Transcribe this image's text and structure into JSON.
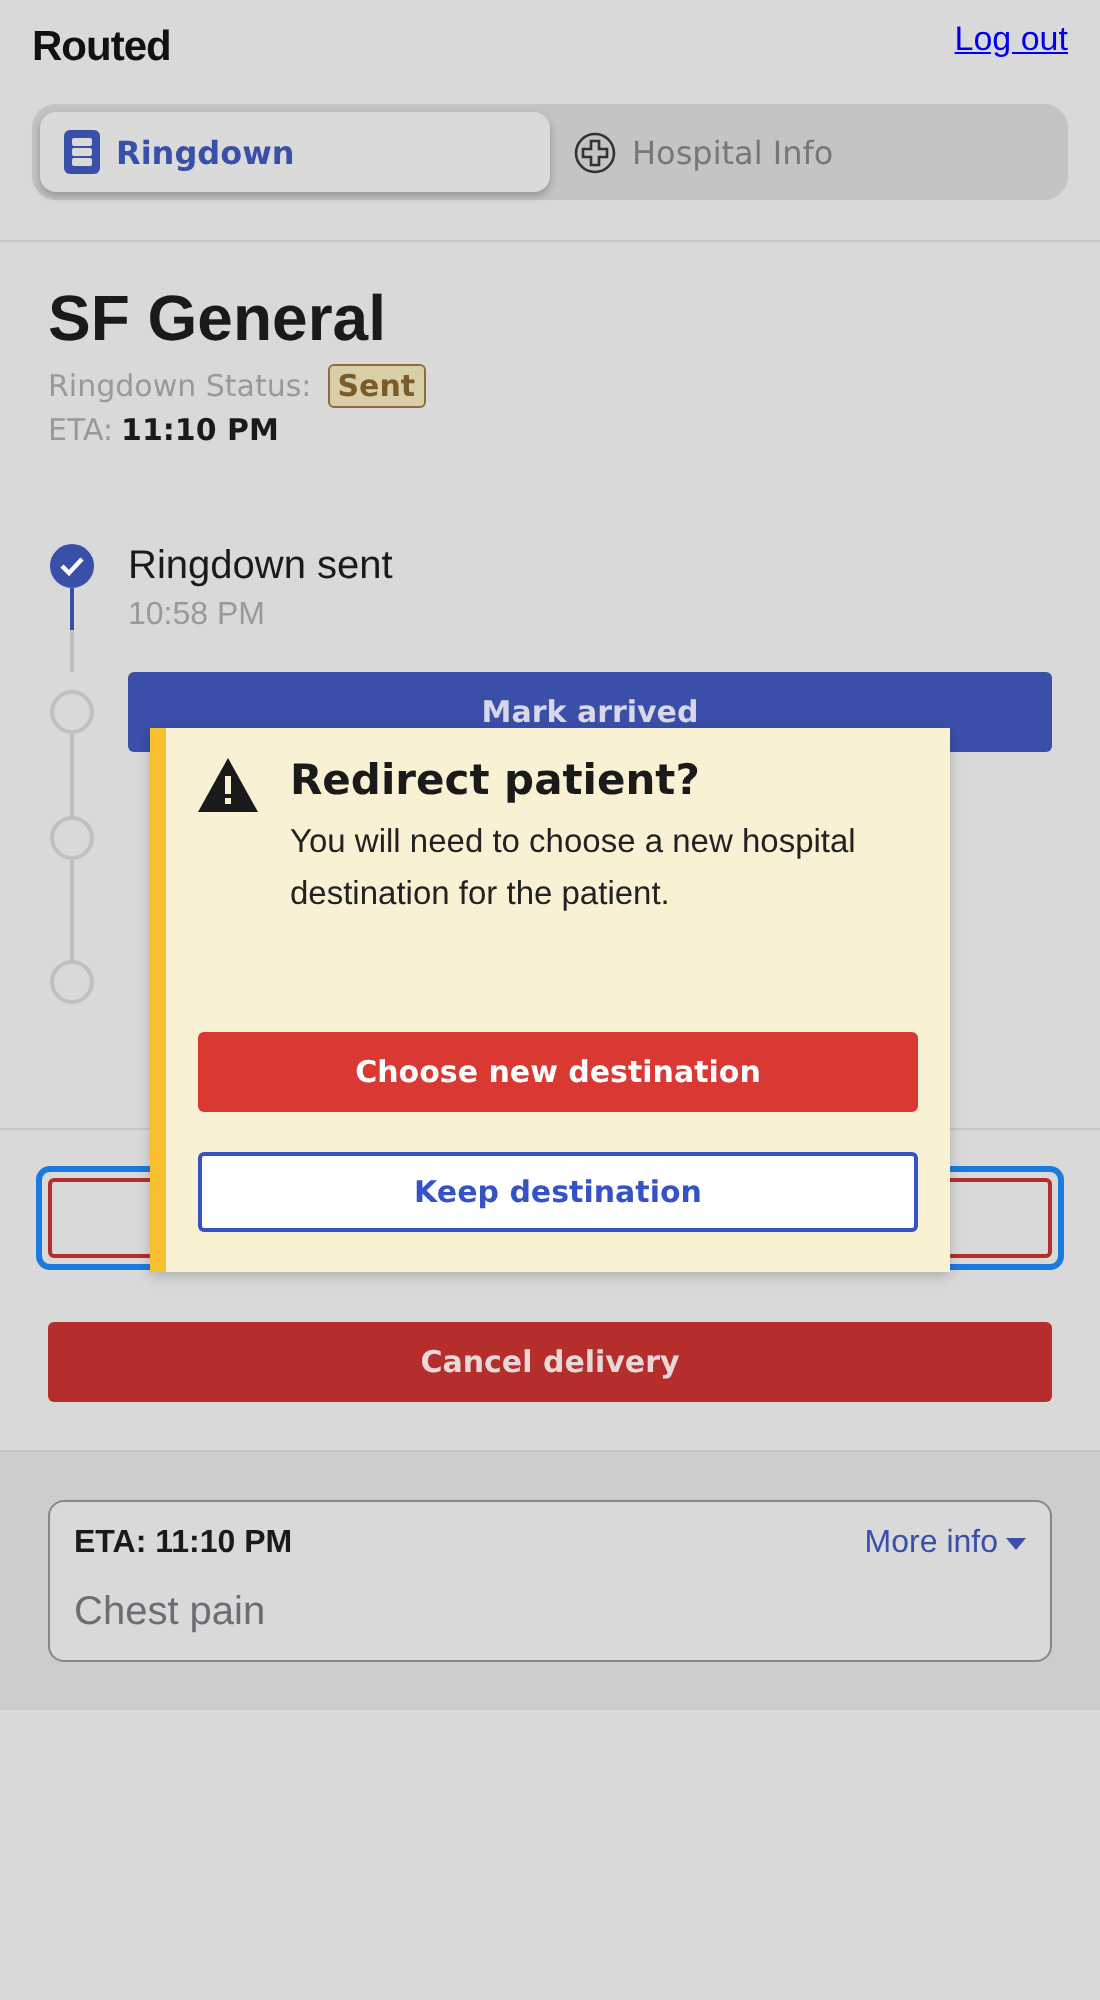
{
  "header": {
    "logo": "Routed",
    "logout": "Log out"
  },
  "tabs": [
    {
      "label": "Ringdown",
      "selected": true
    },
    {
      "label": "Hospital Info",
      "selected": false
    }
  ],
  "hospital": {
    "name": "SF General",
    "status_label": "Ringdown Status:",
    "status": "Sent",
    "eta_label": "ETA:",
    "eta": "11:10 PM"
  },
  "timeline": [
    {
      "completed": true,
      "label": "Ringdown sent",
      "time": "10:58 PM"
    },
    {
      "completed": false,
      "action": "Mark arrived"
    },
    {
      "completed": false
    },
    {
      "completed": false
    }
  ],
  "actions": [
    {
      "kind": "outline",
      "focused": true
    },
    {
      "kind": "danger",
      "label": "Cancel delivery"
    }
  ],
  "summary": {
    "eta": "ETA: 11:10 PM",
    "more": "More info",
    "complaint": "Chest pain"
  },
  "dialog": {
    "title": "Redirect patient?",
    "body": "You will need to choose a new hospital destination for the patient.",
    "buttons": [
      {
        "kind": "primary",
        "label": "Choose new destination"
      },
      {
        "kind": "secondary",
        "label": "Keep destination"
      }
    ]
  }
}
